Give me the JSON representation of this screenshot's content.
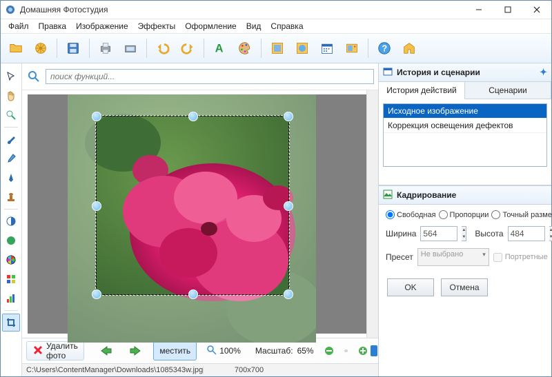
{
  "window": {
    "title": "Домашняя Фотостудия"
  },
  "menu": {
    "file": "Файл",
    "edit": "Правка",
    "image": "Изображение",
    "effects": "Эффекты",
    "decor": "Оформление",
    "view": "Вид",
    "help": "Справка"
  },
  "search": {
    "placeholder": "поиск функций..."
  },
  "bottom": {
    "delete": "Удалить фото",
    "fit": "местить",
    "zoom100_prefix": "100%",
    "scale_label": "Масштаб:",
    "scale_value": "65%"
  },
  "status": {
    "path": "C:\\Users\\ContentManager\\Downloads\\1085343w.jpg",
    "dims": "700x700"
  },
  "right": {
    "history_title": "История и сценарии",
    "tabs": {
      "history": "История действий",
      "scenarios": "Сценарии"
    },
    "items": {
      "original": "Исходное изображение",
      "correction": "Коррекция освещения дефектов"
    },
    "crop_title": "Кадрирование",
    "mode": {
      "free": "Свободная",
      "prop": "Пропорции",
      "exact": "Точный размер"
    },
    "dims": {
      "w_label": "Ширина",
      "w_value": "564",
      "h_label": "Высота",
      "h_value": "484"
    },
    "preset": {
      "label": "Пресет",
      "value": "Не выбрано",
      "portrait": "Портретные"
    },
    "buttons": {
      "ok": "OK",
      "cancel": "Отмена"
    }
  }
}
